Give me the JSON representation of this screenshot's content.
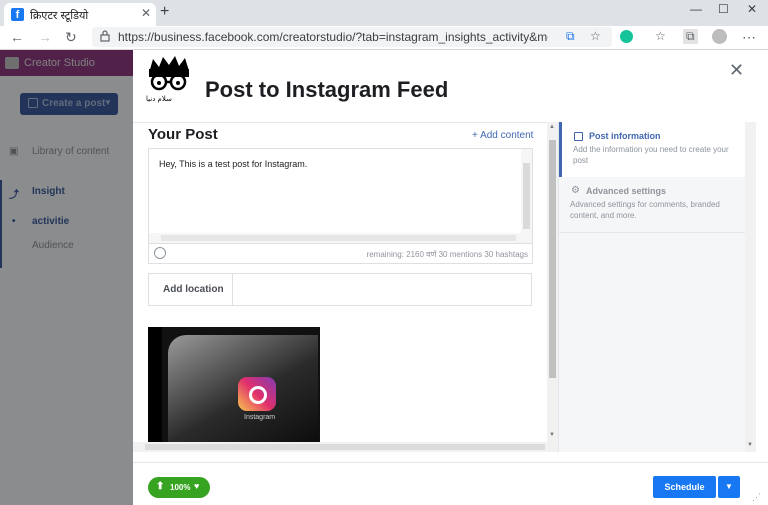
{
  "browser": {
    "tab_title": "क्रिएटर स्टूडियो",
    "tab_close": "✕",
    "new_tab": "+",
    "minimize": "—",
    "maximize": "☐",
    "close": "✕",
    "url": "https://business.facebook.com/creatorstudio/?tab=instagram_insights_activity&mode=instagra..."
  },
  "studio": {
    "brand": "Creator Studio",
    "create_post": "Create a post",
    "sidebar": [
      {
        "label": "Library of content"
      },
      {
        "label": "Insight"
      },
      {
        "label": "activitie"
      },
      {
        "label": "Audience"
      }
    ]
  },
  "modal": {
    "title": "Post to Instagram Feed",
    "avatar_caption": "سلام دنیا",
    "your_post": "Your Post",
    "add_content": "+ Add content",
    "post_text": "Hey, This is a test post for Instagram.",
    "remaining": "remaining: 2160 वर्ण 30 mentions 30 hashtags",
    "add_location": "Add location",
    "photo_caption": "Instagram",
    "right_panel": {
      "post_information": {
        "heading": "Post information",
        "desc": "Add the information you need to create your post"
      },
      "advanced_settings": {
        "heading": "Advanced settings",
        "desc": "Advanced settings for comments, branded content, and more."
      }
    },
    "footer": {
      "progress": "100%",
      "schedule": "Schedule"
    }
  },
  "colors": {
    "accent": "#1877f2",
    "link": "#4267b2",
    "success": "#36a420",
    "brand_header": "#8c3a7e"
  }
}
